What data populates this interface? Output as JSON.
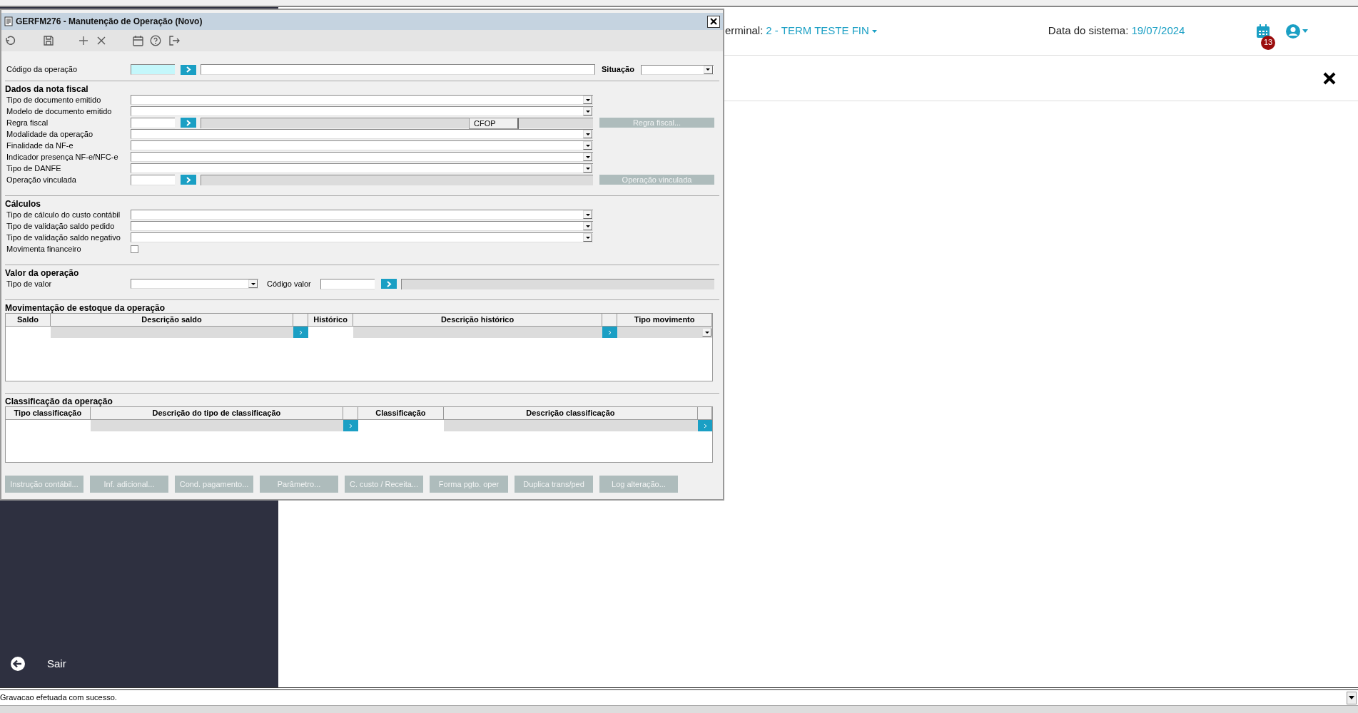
{
  "window": {
    "title": "GERFM276 - Manutenção de Operação (Novo)"
  },
  "header": {
    "terminal_label": "erminal:",
    "terminal_value": "2 - TERM TESTE FIN",
    "date_label": "Data do sistema:",
    "date_value": "19/07/2024",
    "notification_count": "13"
  },
  "sidebar": {
    "exit_label": "Sair"
  },
  "form": {
    "code_label": "Código da operação",
    "status_label": "Situação",
    "sections": [
      {
        "title": "Dados da nota fiscal",
        "fields": [
          {
            "kind": "select",
            "label": "Tipo de documento emitido"
          },
          {
            "kind": "select",
            "label": "Modelo de documento emitido"
          },
          {
            "kind": "lookup",
            "label": "Regra fiscal",
            "inner_label": "CFOP",
            "button": {
              "label": "Regra fiscal...",
              "disabled": true
            }
          },
          {
            "kind": "select",
            "label": "Modalidade da operação"
          },
          {
            "kind": "select",
            "label": "Finalidade da NF-e"
          },
          {
            "kind": "select",
            "label": "Indicador presença NF-e/NFC-e"
          },
          {
            "kind": "select",
            "label": "Tipo de DANFE"
          },
          {
            "kind": "lookup",
            "label": "Operação vinculada",
            "button": {
              "label": "Operação vinculada",
              "disabled": true
            }
          }
        ]
      },
      {
        "title": "Cálculos",
        "fields": [
          {
            "kind": "select",
            "label": "Tipo de cálculo do custo contábil"
          },
          {
            "kind": "select",
            "label": "Tipo de validação saldo pedido"
          },
          {
            "kind": "select",
            "label": "Tipo de validação saldo negativo"
          },
          {
            "kind": "checkbox",
            "label": "Movimenta financeiro",
            "checked": false
          }
        ]
      },
      {
        "title": "Valor da operação",
        "fields": [
          {
            "kind": "select_lookup",
            "label": "Tipo de valor",
            "second_label": "Código valor"
          }
        ]
      }
    ],
    "tables": [
      {
        "title": "Movimentação de estoque da operação",
        "columns": [
          {
            "kind": "text",
            "label": "Saldo"
          },
          {
            "kind": "desc",
            "label": "Descrição saldo"
          },
          {
            "kind": "button"
          },
          {
            "kind": "text",
            "label": "Histórico"
          },
          {
            "kind": "desc",
            "label": "Descrição histórico"
          },
          {
            "kind": "button"
          },
          {
            "kind": "select",
            "label": "Tipo movimento"
          }
        ]
      },
      {
        "title": "Classificação da operação",
        "columns": [
          {
            "kind": "text",
            "label": "Tipo classificação"
          },
          {
            "kind": "desc",
            "label": "Descrição do tipo de classificação"
          },
          {
            "kind": "button"
          },
          {
            "kind": "text",
            "label": "Classificação"
          },
          {
            "kind": "desc",
            "label": "Descrição classificação"
          },
          {
            "kind": "button"
          }
        ]
      }
    ],
    "buttons": [
      {
        "label": "Instrução contábil...",
        "disabled": true
      },
      {
        "label": "Inf. adicional...",
        "disabled": true
      },
      {
        "label": "Cond. pagamento...",
        "disabled": true
      },
      {
        "label": "Parâmetro...",
        "disabled": true
      },
      {
        "label": "C. custo / Receita...",
        "disabled": true
      },
      {
        "label": "Forma pgto. oper",
        "disabled": true
      },
      {
        "label": "Duplica trans/ped",
        "disabled": true
      },
      {
        "label": "Log alteração...",
        "disabled": true
      }
    ]
  },
  "status_bar": {
    "message": "Gravacao efetuada com sucesso."
  }
}
